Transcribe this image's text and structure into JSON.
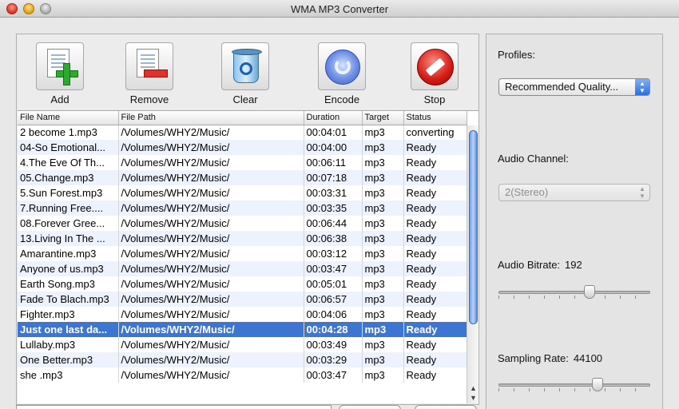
{
  "window": {
    "title": "WMA MP3 Converter"
  },
  "toolbar": {
    "add_label": "Add",
    "remove_label": "Remove",
    "clear_label": "Clear",
    "encode_label": "Encode",
    "stop_label": "Stop"
  },
  "table": {
    "columns": [
      "File Name",
      "File Path",
      "Duration",
      "Target",
      "Status"
    ],
    "rows": [
      [
        "2 become 1.mp3",
        "/Volumes/WHY2/Music/",
        "00:04:01",
        "mp3",
        "converting"
      ],
      [
        "04-So Emotional...",
        "/Volumes/WHY2/Music/",
        "00:04:00",
        "mp3",
        "Ready"
      ],
      [
        "4.The Eve Of Th...",
        "/Volumes/WHY2/Music/",
        "00:06:11",
        "mp3",
        "Ready"
      ],
      [
        "05.Change.mp3",
        "/Volumes/WHY2/Music/",
        "00:07:18",
        "mp3",
        "Ready"
      ],
      [
        "5.Sun Forest.mp3",
        "/Volumes/WHY2/Music/",
        "00:03:31",
        "mp3",
        "Ready"
      ],
      [
        "7.Running Free....",
        "/Volumes/WHY2/Music/",
        "00:03:35",
        "mp3",
        "Ready"
      ],
      [
        "08.Forever Gree...",
        "/Volumes/WHY2/Music/",
        "00:06:44",
        "mp3",
        "Ready"
      ],
      [
        "13.Living In The ...",
        "/Volumes/WHY2/Music/",
        "00:06:38",
        "mp3",
        "Ready"
      ],
      [
        "Amarantine.mp3",
        "/Volumes/WHY2/Music/",
        "00:03:12",
        "mp3",
        "Ready"
      ],
      [
        "Anyone of us.mp3",
        "/Volumes/WHY2/Music/",
        "00:03:47",
        "mp3",
        "Ready"
      ],
      [
        "Earth Song.mp3",
        "/Volumes/WHY2/Music/",
        "00:05:01",
        "mp3",
        "Ready"
      ],
      [
        "Fade To Blach.mp3",
        "/Volumes/WHY2/Music/",
        "00:06:57",
        "mp3",
        "Ready"
      ],
      [
        "Fighter.mp3",
        "/Volumes/WHY2/Music/",
        "00:04:06",
        "mp3",
        "Ready"
      ],
      [
        "Just one last da...",
        "/Volumes/WHY2/Music/",
        "00:04:28",
        "mp3",
        "Ready"
      ],
      [
        "Lullaby.mp3",
        "/Volumes/WHY2/Music/",
        "00:03:49",
        "mp3",
        "Ready"
      ],
      [
        "One Better.mp3",
        "/Volumes/WHY2/Music/",
        "00:03:29",
        "mp3",
        "Ready"
      ],
      [
        "she .mp3",
        "/Volumes/WHY2/Music/",
        "00:03:47",
        "mp3",
        "Ready"
      ]
    ],
    "selected_row": 13
  },
  "settings": {
    "profiles_label": "Profiles:",
    "profile_value": "Recommended Quality...",
    "channel_label": "Audio Channel:",
    "channel_value": "2(Stereo)",
    "bitrate_label": "Audio Bitrate:",
    "bitrate_value": "192",
    "bitrate_level": 0.6,
    "sampling_label": "Sampling Rate:",
    "sampling_value": "44100",
    "sampling_level": 0.65
  },
  "colors": {
    "selection": "#3d75d2",
    "stripe": "#edf3fe"
  }
}
